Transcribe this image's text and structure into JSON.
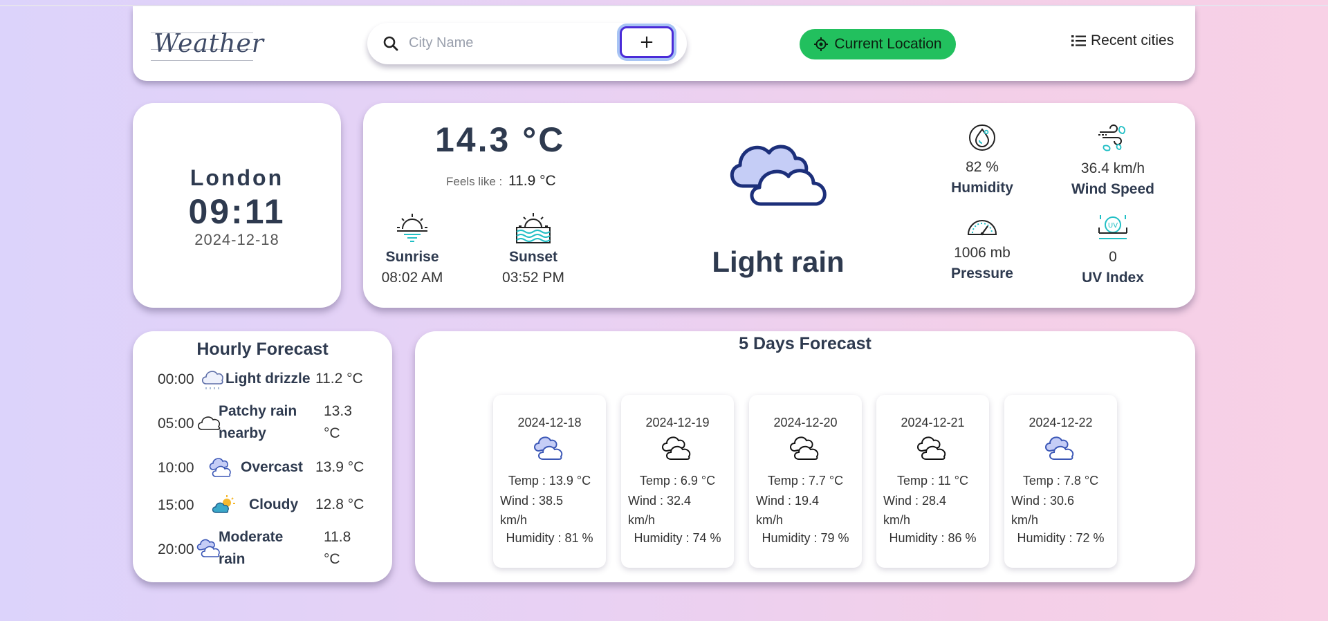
{
  "header": {
    "logo_text": "Weather",
    "search": {
      "placeholder": "City Name",
      "value": ""
    },
    "add_label": "+",
    "current_location_label": "Current Location",
    "recent_cities_label": "Recent cities"
  },
  "city": {
    "name": "London",
    "time": "09:11",
    "date": "2024-12-18"
  },
  "current": {
    "temperature": "14.3 °C",
    "feels_like_label": "Feels like :",
    "feels_like_value": "11.9 °C",
    "sunrise_label": "Sunrise",
    "sunrise_time": "08:02 AM",
    "sunset_label": "Sunset",
    "sunset_time": "03:52 PM",
    "condition": "Light rain",
    "humidity_value": "82 %",
    "humidity_label": "Humidity",
    "wind_value": "36.4 km/h",
    "wind_label": "Wind Speed",
    "pressure_value": "1006 mb",
    "pressure_label": "Pressure",
    "uv_value": "0",
    "uv_label": "UV Index"
  },
  "hourly": {
    "title": "Hourly Forecast",
    "rows": [
      {
        "time": "00:00",
        "icon": "light-drizzle-icon",
        "condition": "Light drizzle",
        "temp": "11.2 °C"
      },
      {
        "time": "05:00",
        "icon": "patchy-rain-icon",
        "condition": "Patchy rain nearby",
        "temp": "13.3 °C"
      },
      {
        "time": "10:00",
        "icon": "overcast-icon",
        "condition": "Overcast",
        "temp": "13.9 °C"
      },
      {
        "time": "15:00",
        "icon": "partly-cloudy-icon",
        "condition": "Cloudy",
        "temp": "12.8 °C"
      },
      {
        "time": "20:00",
        "icon": "moderate-rain-icon",
        "condition": "Moderate rain",
        "temp": "11.8 °C"
      }
    ]
  },
  "forecast": {
    "title": "5 Days Forecast",
    "days": [
      {
        "date": "2024-12-18",
        "icon": "blue-cloud-icon",
        "temp": "Temp : 13.9 °C",
        "wind": "Wind : 38.5 km/h",
        "humidity": "Humidity : 81 %"
      },
      {
        "date": "2024-12-19",
        "icon": "cloud-outline-icon",
        "temp": "Temp : 6.9 °C",
        "wind": "Wind : 32.4 km/h",
        "humidity": "Humidity : 74 %"
      },
      {
        "date": "2024-12-20",
        "icon": "cloud-outline-icon",
        "temp": "Temp : 7.7 °C",
        "wind": "Wind : 19.4 km/h",
        "humidity": "Humidity : 79 %"
      },
      {
        "date": "2024-12-21",
        "icon": "cloud-outline-icon",
        "temp": "Temp : 11 °C",
        "wind": "Wind : 28.4 km/h",
        "humidity": "Humidity : 86 %"
      },
      {
        "date": "2024-12-22",
        "icon": "blue-cloud-icon",
        "temp": "Temp : 7.8 °C",
        "wind": "Wind : 30.6 km/h",
        "humidity": "Humidity : 72 %"
      }
    ]
  },
  "colors": {
    "accent_green": "#22c05e",
    "add_border": "#4a2bd8",
    "text_dark": "#2e3a4f",
    "cloud_fill": "#c5cdf6",
    "cloud_stroke": "#1c2f7a"
  }
}
